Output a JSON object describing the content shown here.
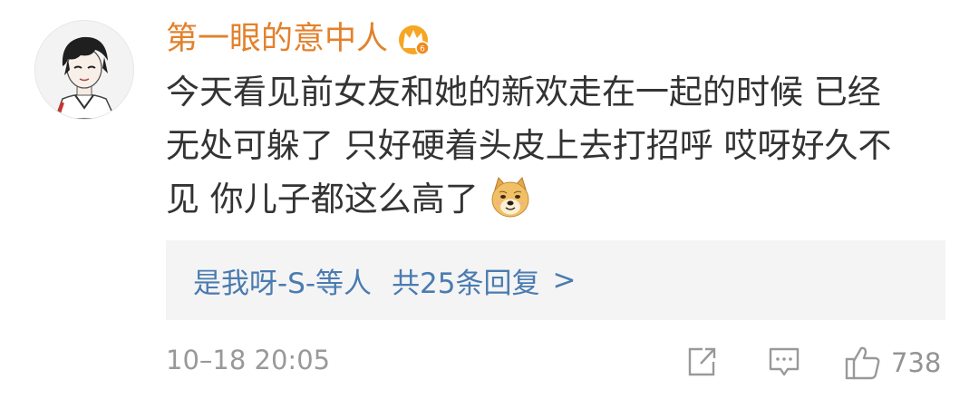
{
  "comment": {
    "username": "第一眼的意中人",
    "badge_icon": "crown-vip-icon",
    "text_lines": [
      "今天看见前女友和她的新欢走在一起的时候 已经",
      "无处可躲了 只好硬着头皮上去打招呼 哎呀好久不",
      "见 你儿子都这么高了"
    ],
    "emoji_icon": "doge-emoji-icon",
    "replies": {
      "names": "是我呀-S-等人",
      "count_text": "共25条回复",
      "chevron": ">"
    },
    "timestamp": "10–18 20:05",
    "like_count": "738"
  },
  "colors": {
    "username": "#e2812c",
    "link": "#4a7bb1",
    "text": "#333333",
    "meta": "#999999",
    "reply_background": "#f4f4f4"
  }
}
